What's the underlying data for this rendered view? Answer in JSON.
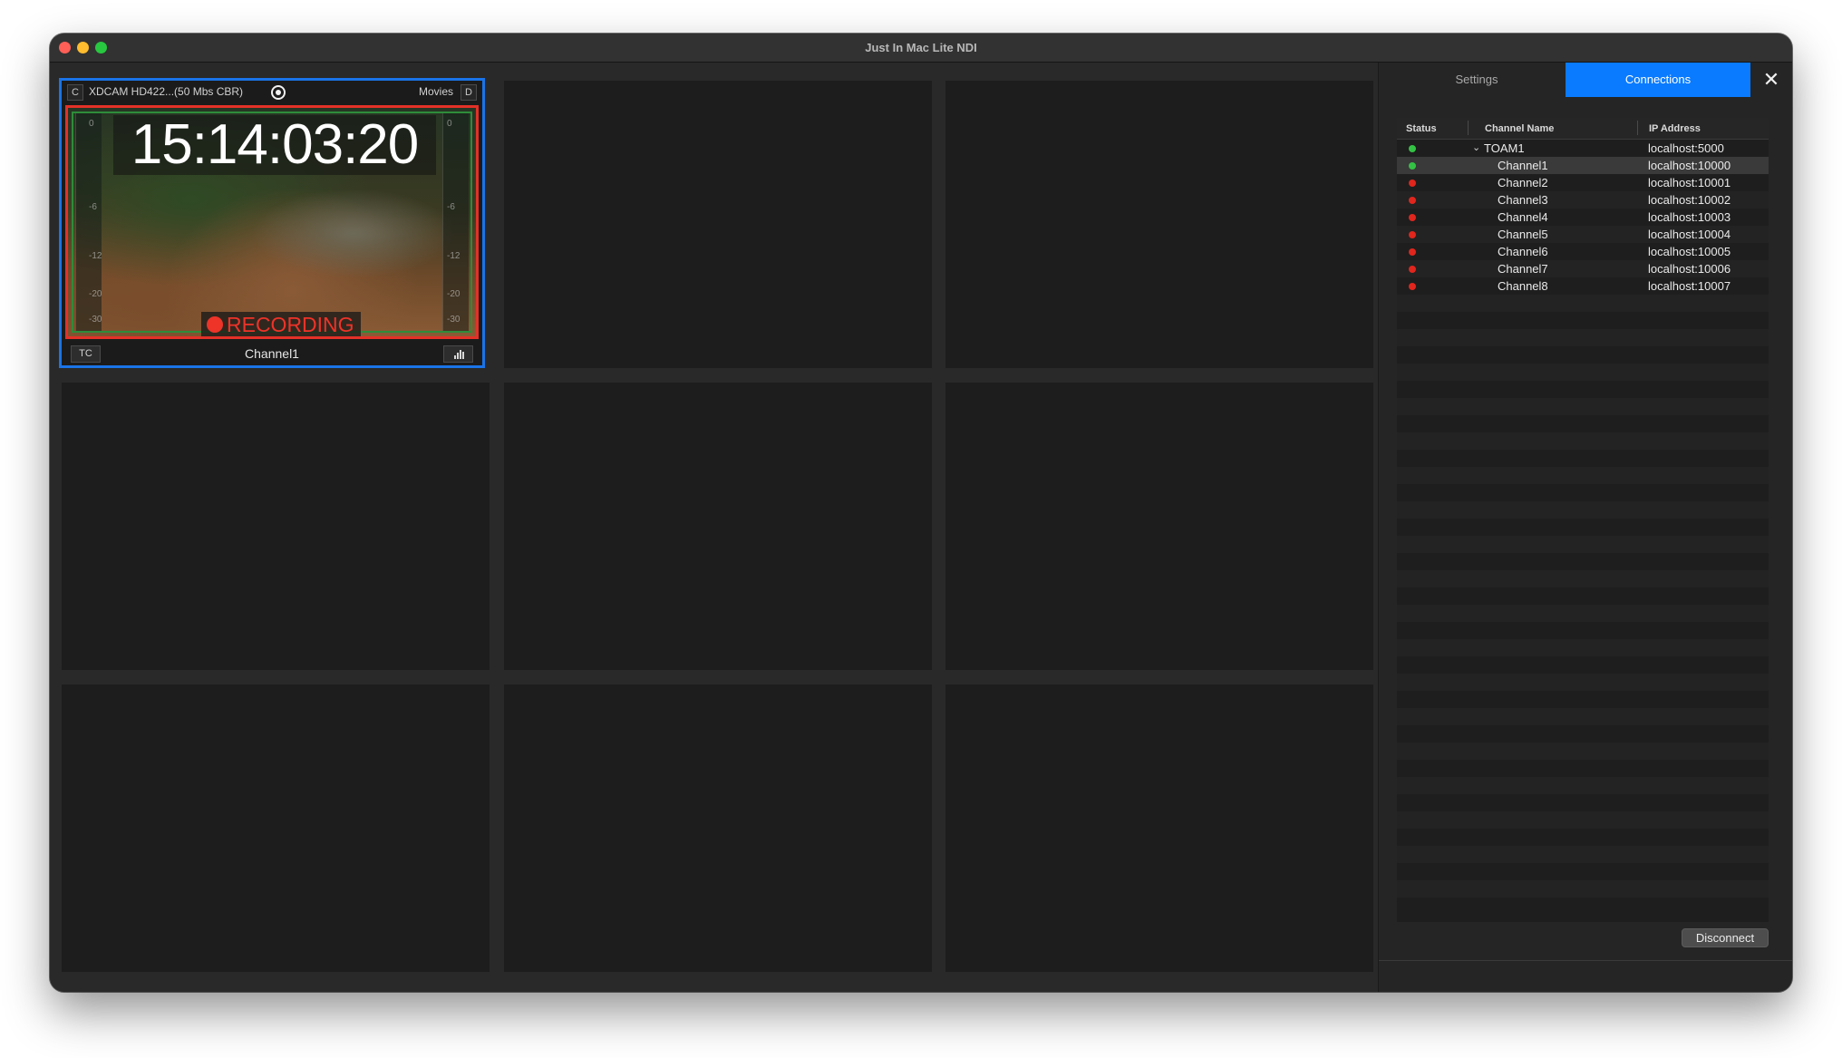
{
  "window": {
    "title": "Just In Mac Lite NDI"
  },
  "active_channel": {
    "key_left": "C",
    "codec": "XDCAM HD422...(50 Mbs CBR)",
    "destination": "Movies",
    "key_right": "D",
    "timecode": "15:14:03:20",
    "recording_label": "RECORDING",
    "tc_button": "TC",
    "channel_name": "Channel1",
    "meter_scale": [
      "0",
      "-6",
      "-12",
      "-20",
      "-30"
    ]
  },
  "panel": {
    "tabs": {
      "settings": "Settings",
      "connections": "Connections",
      "active": "connections"
    },
    "table": {
      "columns": {
        "status": "Status",
        "channel": "Channel Name",
        "ip": "IP Address"
      },
      "rows": [
        {
          "status": "green",
          "name": "TOAM1",
          "ip": "localhost:5000",
          "group": true
        },
        {
          "status": "green",
          "name": "Channel1",
          "ip": "localhost:10000",
          "selected": true
        },
        {
          "status": "red",
          "name": "Channel2",
          "ip": "localhost:10001"
        },
        {
          "status": "red",
          "name": "Channel3",
          "ip": "localhost:10002"
        },
        {
          "status": "red",
          "name": "Channel4",
          "ip": "localhost:10003"
        },
        {
          "status": "red",
          "name": "Channel5",
          "ip": "localhost:10004"
        },
        {
          "status": "red",
          "name": "Channel6",
          "ip": "localhost:10005"
        },
        {
          "status": "red",
          "name": "Channel7",
          "ip": "localhost:10006"
        },
        {
          "status": "red",
          "name": "Channel8",
          "ip": "localhost:10007"
        }
      ]
    },
    "disconnect_label": "Disconnect"
  },
  "colors": {
    "accent": "#0a7bff",
    "active_border": "#1a74e8",
    "recording": "#ee3328",
    "status_green": "#34c245",
    "status_red": "#e0261d"
  },
  "icons": [
    "close-icon",
    "record-indicator-icon",
    "audio-meter-icon",
    "chevron-down-icon",
    "status-dot-icon"
  ]
}
